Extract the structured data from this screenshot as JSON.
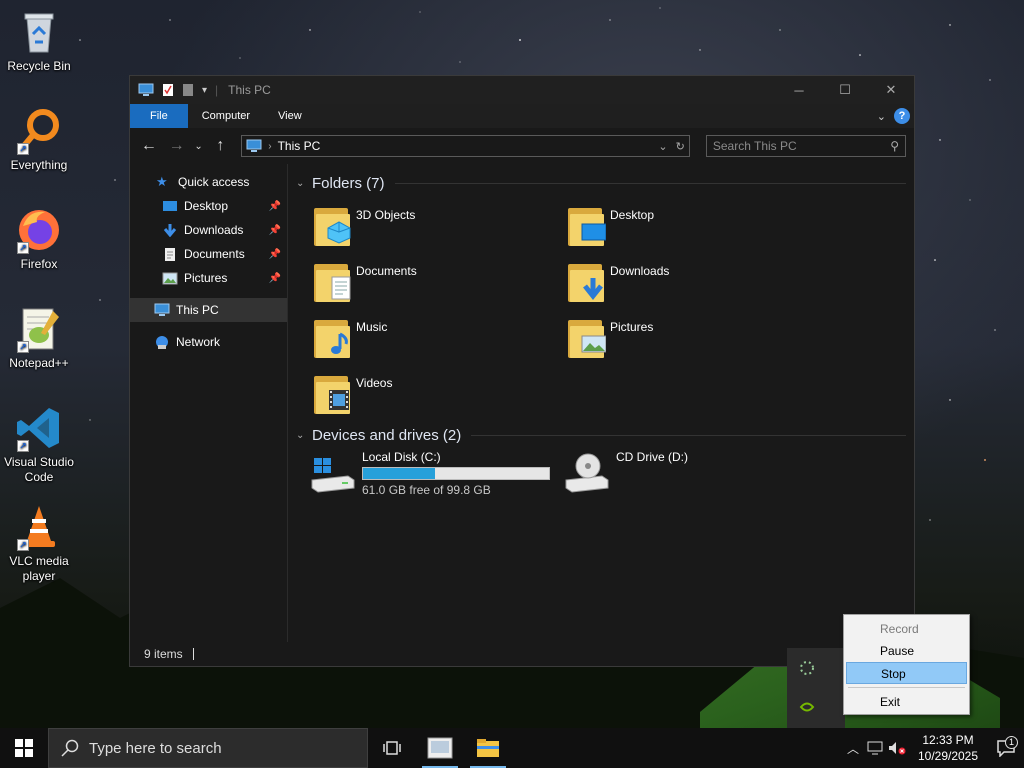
{
  "desktop": {
    "icons": [
      {
        "label": "Recycle Bin"
      },
      {
        "label": "Everything"
      },
      {
        "label": "Firefox"
      },
      {
        "label": "Notepad++"
      },
      {
        "label": "Visual Studio Code"
      },
      {
        "label": "VLC media player"
      }
    ]
  },
  "window": {
    "title": "This PC",
    "ribbon_tabs": {
      "file": "File",
      "computer": "Computer",
      "view": "View"
    },
    "help_glyph": "?",
    "address": {
      "location": "This PC"
    },
    "search": {
      "placeholder": "Search This PC"
    },
    "nav": {
      "quick_access": "Quick access",
      "desktop": "Desktop",
      "downloads": "Downloads",
      "documents": "Documents",
      "pictures": "Pictures",
      "this_pc": "This PC",
      "network": "Network"
    },
    "folders_header": "Folders (7)",
    "folders": [
      {
        "name": "3D Objects",
        "icon": "3d-objects-icon"
      },
      {
        "name": "Desktop",
        "icon": "desktop-folder-icon"
      },
      {
        "name": "Documents",
        "icon": "documents-folder-icon"
      },
      {
        "name": "Downloads",
        "icon": "downloads-folder-icon"
      },
      {
        "name": "Music",
        "icon": "music-folder-icon"
      },
      {
        "name": "Pictures",
        "icon": "pictures-folder-icon"
      },
      {
        "name": "Videos",
        "icon": "videos-folder-icon"
      }
    ],
    "drives_header": "Devices and drives (2)",
    "drives": {
      "c": {
        "name": "Local Disk (C:)",
        "free_text": "61.0 GB free of 99.8 GB",
        "used_fraction": 0.389
      },
      "d": {
        "name": "CD Drive (D:)"
      }
    },
    "status": {
      "items": "9 items"
    }
  },
  "context_menu": {
    "record": "Record",
    "pause": "Pause",
    "stop": "Stop",
    "exit": "Exit"
  },
  "taskbar": {
    "search_placeholder": "Type here to search",
    "time": "12:33 PM",
    "date": "10/29/2025",
    "notification_count": "1"
  },
  "colors": {
    "accent": "#1a6cbf",
    "progress": "#26a0da",
    "folder": "#f3d36b",
    "menu_highlight": "#91c9f7"
  }
}
